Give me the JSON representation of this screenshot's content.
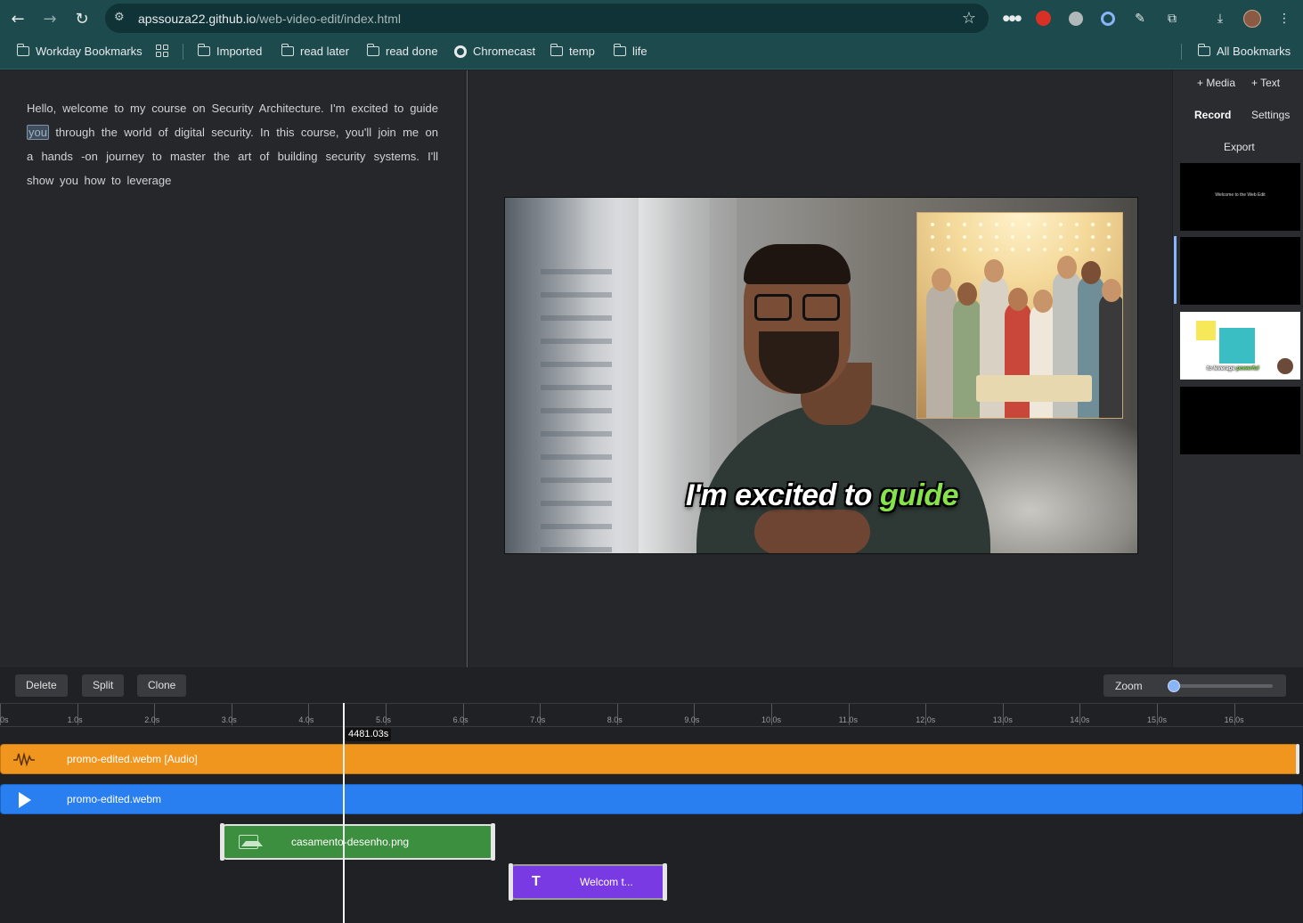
{
  "browser": {
    "url_host": "apssouza22.github.io",
    "url_path": "/web-video-edit/index.html",
    "bookmarks": [
      {
        "label": "Workday Bookmarks",
        "icon": "folder-icon"
      },
      {
        "label": "Imported",
        "icon": "folder-icon"
      },
      {
        "label": "read later",
        "icon": "folder-icon"
      },
      {
        "label": "read done",
        "icon": "folder-icon"
      },
      {
        "label": "Chromecast",
        "icon": "globe-icon"
      },
      {
        "label": "temp",
        "icon": "folder-icon"
      },
      {
        "label": "life",
        "icon": "folder-icon"
      }
    ],
    "all_bookmarks": "All Bookmarks"
  },
  "transcript": {
    "before": "Hello, welcome to my course on Security Architecture. I'm excited to guide",
    "highlight": "you",
    "after": "through the world of digital security. In this course, you'll join me on a hands -on journey to master the art of building security systems. I'll show you how to leverage"
  },
  "preview": {
    "subtitle_prefix": "I'm excited to",
    "subtitle_highlight": "guide"
  },
  "side_panel": {
    "media": "+ Media",
    "text": "+ Text",
    "record": "Record",
    "settings": "Settings",
    "export": "Export",
    "thumb1_caption": "Welcome to the Web Edit",
    "thumb3_caption_prefix": "to leverage",
    "thumb3_caption_highlight": "powerful"
  },
  "timeline": {
    "buttons": {
      "delete": "Delete",
      "split": "Split",
      "clone": "Clone"
    },
    "zoom_label": "Zoom",
    "zoom_level": 0.0,
    "ruler_labels": [
      "0s",
      "1.0s",
      "2.0s",
      "3.0s",
      "4.0s",
      "5.0s",
      "6.0s",
      "7.0s",
      "8.0s",
      "9.0s",
      "10.0s",
      "11.0s",
      "12.0s",
      "13.0s",
      "14.0s",
      "15.0s",
      "16.0s"
    ],
    "playhead_time": "4481.03s",
    "tracks": {
      "audio": "promo-edited.webm [Audio]",
      "video": "promo-edited.webm",
      "image": "casamento-desenho.png",
      "text": "Welcom t..."
    },
    "colors": {
      "audio": "#f0961e",
      "video": "#2a7ff0",
      "image": "#3c8f3e",
      "text": "#7a3ae3"
    }
  }
}
